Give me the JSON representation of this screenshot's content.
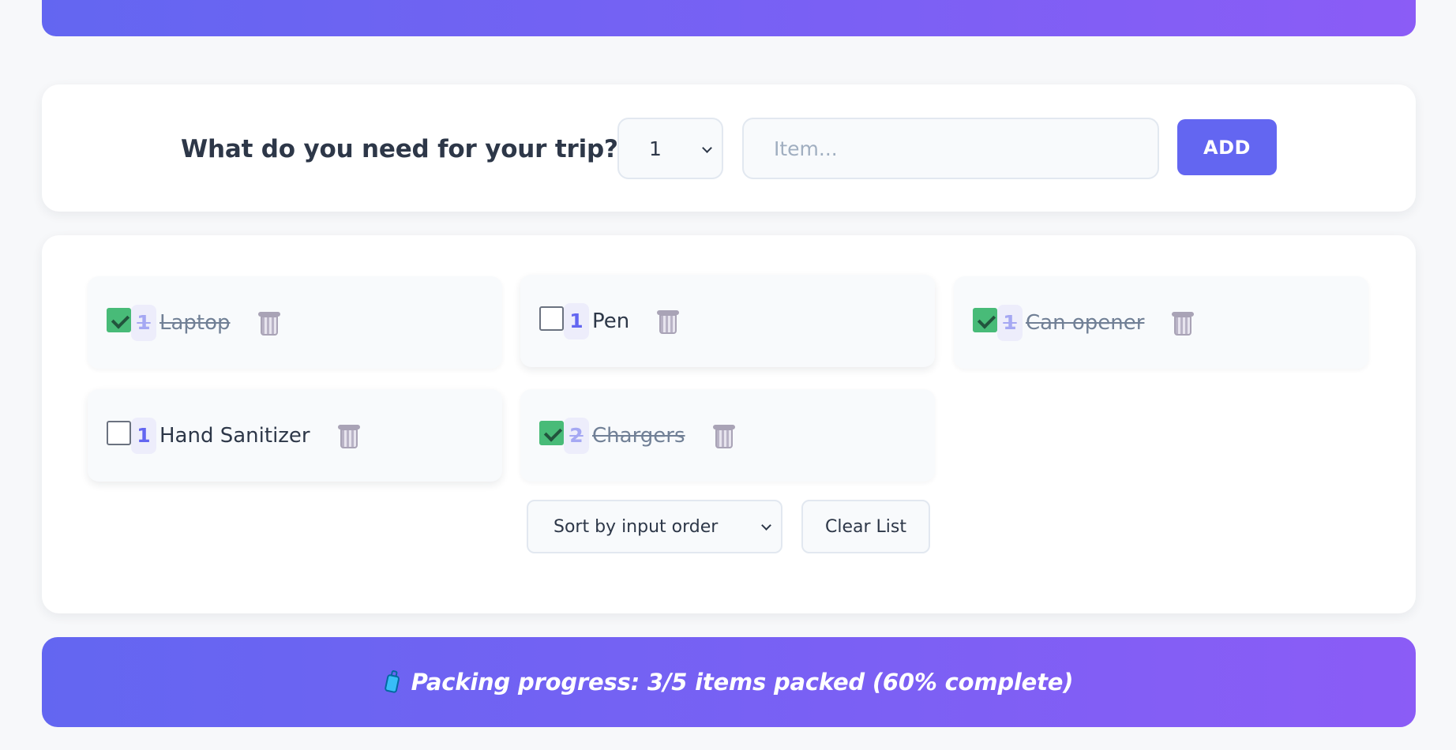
{
  "form": {
    "title": "What do you need for your trip?",
    "title_icon": "backpack-icon",
    "quantity_value": "1",
    "item_placeholder": "Item...",
    "add_label": "ADD"
  },
  "items": [
    {
      "quantity": "1",
      "name": "Laptop",
      "packed": true
    },
    {
      "quantity": "1",
      "name": "Pen",
      "packed": false
    },
    {
      "quantity": "1",
      "name": "Can opener",
      "packed": true
    },
    {
      "quantity": "1",
      "name": "Hand Sanitizer",
      "packed": false
    },
    {
      "quantity": "2",
      "name": "Chargers",
      "packed": true
    }
  ],
  "controls": {
    "sort_value": "Sort by input order",
    "clear_label": "Clear List"
  },
  "stats": {
    "icon": "luggage-icon",
    "text": "Packing progress: 3/5 items packed (60% complete)",
    "packed_count": 3,
    "total_count": 5,
    "percent_complete": 60
  },
  "colors": {
    "accent": "#6366f1",
    "accent_end": "#8b5cf6",
    "checked": "#48bb78",
    "background": "#f7f8fa"
  }
}
